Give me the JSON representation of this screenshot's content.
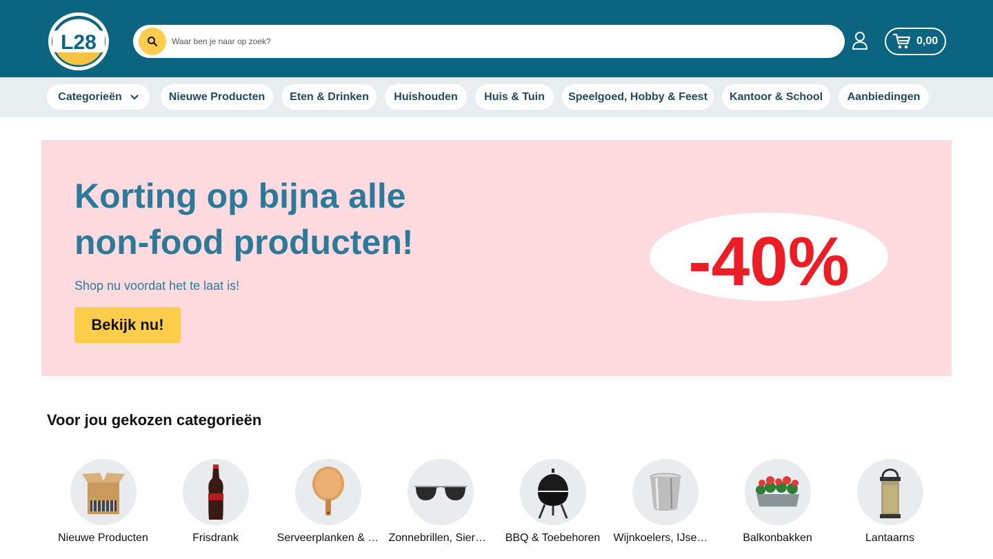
{
  "header": {
    "logo_text": "L28",
    "search": {
      "placeholder": "Waar ben je naar op zoek?",
      "icon": "search-icon"
    },
    "user_icon": "user-icon",
    "cart": {
      "icon": "cart-icon",
      "total": "0,00"
    }
  },
  "nav": {
    "categories_label": "Categorieën",
    "items": [
      "Nieuwe Producten",
      "Eten & Drinken",
      "Huishouden",
      "Huis & Tuin",
      "Speelgoed, Hobby & Feest",
      "Kantoor & School",
      "Aanbiedingen"
    ]
  },
  "banner": {
    "title": "Korting op bijna alle non-food producten!",
    "subtitle": "Shop nu voordat het te laat is!",
    "cta": "Bekijk nu!",
    "promo_text": "-40%"
  },
  "categories": {
    "title": "Voor jou gekozen categorieën",
    "items": [
      {
        "label": "Nieuwe Producten",
        "icon": "box-icon"
      },
      {
        "label": "Frisdrank",
        "icon": "bottle-icon"
      },
      {
        "label": "Serveerplanken & …",
        "icon": "board-icon"
      },
      {
        "label": "Zonnebrillen, Siera…",
        "icon": "sunglasses-icon"
      },
      {
        "label": "BBQ & Toebehoren",
        "icon": "bbq-icon"
      },
      {
        "label": "Wijnkoelers, IJsem…",
        "icon": "ice-bucket-icon"
      },
      {
        "label": "Balkonbakken",
        "icon": "planter-icon"
      },
      {
        "label": "Lantaarns",
        "icon": "lantern-icon"
      }
    ]
  },
  "colors": {
    "header_bg": "#0b6580",
    "accent_yellow": "#ffcd4c",
    "banner_bg": "#ffdbdf",
    "banner_text": "#2b7a99",
    "promo_red": "#ee1c25"
  }
}
